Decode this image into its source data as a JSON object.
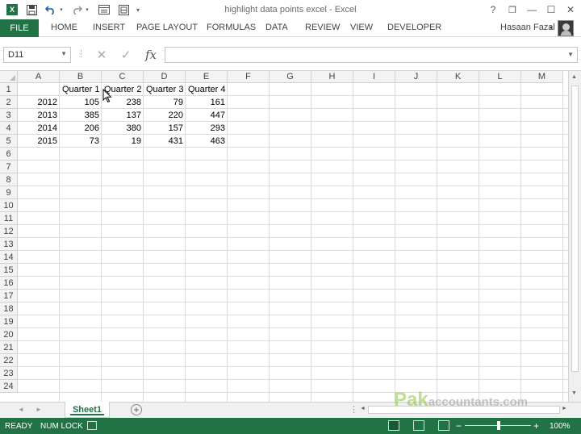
{
  "window": {
    "title": "highlight data points excel - Excel",
    "app_icon_letter": "X",
    "help": "?",
    "restore": "❐",
    "minimize": "—",
    "maximize": "☐",
    "close": "✕"
  },
  "quick_access": {
    "save_icon": "save-icon",
    "undo_icon": "undo-icon",
    "redo_icon": "redo-icon",
    "customize": "▾"
  },
  "ribbon": {
    "file": "FILE",
    "tabs": [
      "HOME",
      "INSERT",
      "PAGE LAYOUT",
      "FORMULAS",
      "DATA",
      "REVIEW",
      "VIEW",
      "DEVELOPER"
    ],
    "user_name": "Hasaan Fazal",
    "user_dropdown": "▾"
  },
  "formula_bar": {
    "name_box": "D11",
    "cancel": "✕",
    "enter": "✓",
    "fx": "fx",
    "formula": ""
  },
  "grid": {
    "columns": [
      "A",
      "B",
      "C",
      "D",
      "E",
      "F",
      "G",
      "H",
      "I",
      "J",
      "K",
      "L",
      "M"
    ],
    "rows": [
      "1",
      "2",
      "3",
      "4",
      "5",
      "6",
      "7",
      "8",
      "9",
      "10",
      "11",
      "12",
      "13",
      "14",
      "15",
      "16",
      "17",
      "18",
      "19",
      "20",
      "21",
      "22",
      "23",
      "24"
    ],
    "header_row": [
      "",
      "Quarter 1",
      "Quarter 2",
      "Quarter 3",
      "Quarter 4"
    ],
    "data_rows": [
      [
        "2012",
        "105",
        "238",
        "79",
        "161"
      ],
      [
        "2013",
        "385",
        "137",
        "220",
        "447"
      ],
      [
        "2014",
        "206",
        "380",
        "157",
        "293"
      ],
      [
        "2015",
        "73",
        "19",
        "431",
        "463"
      ]
    ]
  },
  "sheets": {
    "active": "Sheet1",
    "add": "+"
  },
  "watermark": {
    "brand": "Pak",
    "rest": "accountants.com"
  },
  "status": {
    "ready": "READY",
    "num_lock": "NUM LOCK",
    "zoom_minus": "−",
    "zoom_plus": "+",
    "zoom_level": "100%"
  },
  "colors": {
    "excel_green": "#217346",
    "grid_line": "#dcdcdc",
    "header_bg": "#f3f3f3"
  }
}
